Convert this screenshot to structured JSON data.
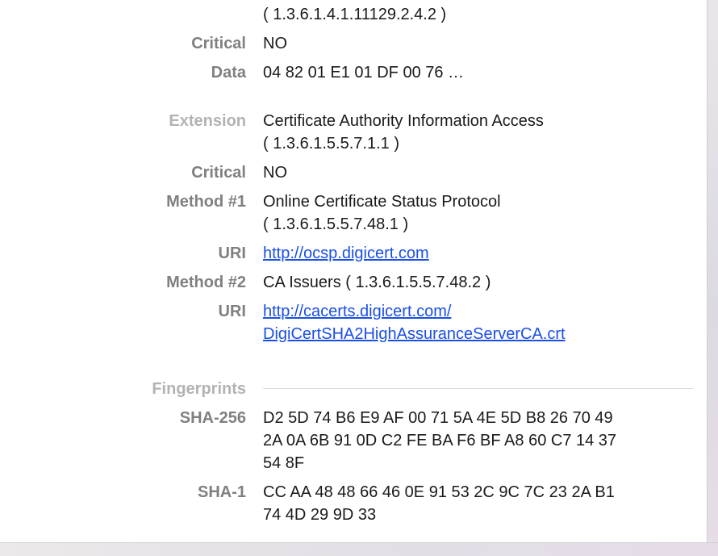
{
  "top_oid": "( 1.3.6.1.4.1.11129.2.4.2 )",
  "sct": {
    "critical_label": "Critical",
    "critical_value": "NO",
    "data_label": "Data",
    "data_value": "04 82 01 E1 01 DF 00 76 …"
  },
  "aia": {
    "extension_label": "Extension",
    "extension_name": "Certificate Authority Information Access",
    "extension_oid": "( 1.3.6.1.5.5.7.1.1 )",
    "critical_label": "Critical",
    "critical_value": "NO",
    "method1_label": "Method #1",
    "method1_name": "Online Certificate Status Protocol",
    "method1_oid": "( 1.3.6.1.5.5.7.48.1 )",
    "uri1_label": "URI",
    "uri1_value": "http://ocsp.digicert.com",
    "method2_label": "Method #2",
    "method2_value": "CA Issuers ( 1.3.6.1.5.5.7.48.2 )",
    "uri2_label": "URI",
    "uri2_line1": "http://cacerts.digicert.com/",
    "uri2_line2": "DigiCertSHA2HighAssuranceServerCA.crt"
  },
  "fingerprints": {
    "section_label": "Fingerprints",
    "sha256_label": "SHA-256",
    "sha256_lines": [
      "D2 5D 74 B6 E9 AF 00 71 5A 4E 5D B8 26 70 49",
      "2A 0A 6B 91 0D C2 FE BA F6 BF A8 60 C7 14 37",
      "54 8F"
    ],
    "sha1_label": "SHA-1",
    "sha1_lines": [
      "CC AA 48 48 66 46 0E 91 53 2C 9C 7C 23 2A B1",
      "74 4D 29 9D 33"
    ]
  },
  "colors": {
    "label": "#808080",
    "section_label": "#b3b3b3",
    "value": "#1a1a1a",
    "link": "#1a4fe6"
  }
}
